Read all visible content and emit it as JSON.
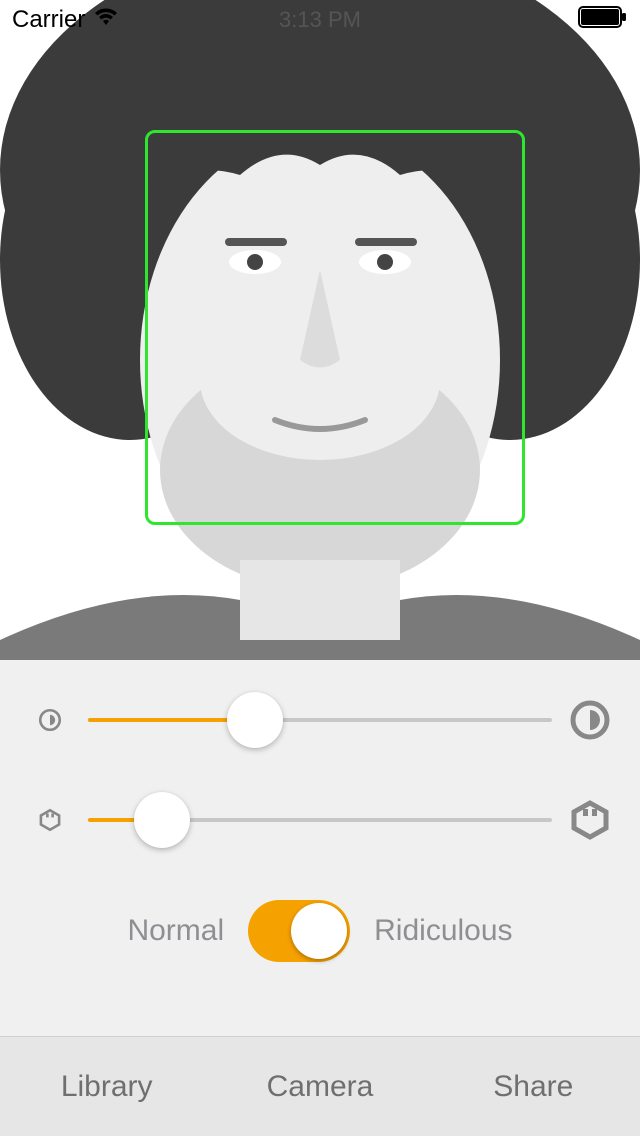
{
  "status": {
    "carrier": "Carrier",
    "time": "3:13 PM"
  },
  "sliders": {
    "eye": {
      "percent": 36
    },
    "face": {
      "percent": 16
    }
  },
  "toggle": {
    "left_label": "Normal",
    "right_label": "Ridiculous",
    "on": true
  },
  "toolbar": {
    "library": "Library",
    "camera": "Camera",
    "share": "Share"
  },
  "colors": {
    "accent": "#f5a100",
    "face_box": "#2ee62e"
  }
}
